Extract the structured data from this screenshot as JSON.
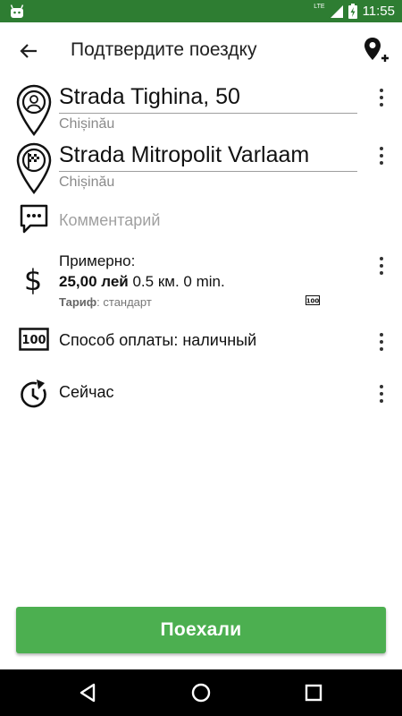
{
  "status_bar": {
    "network": "LTE",
    "time": "11:55"
  },
  "toolbar": {
    "title": "Подтвердите поездку"
  },
  "route": {
    "from": {
      "address": "Strada Tighina, 50",
      "city": "Chișinău"
    },
    "to": {
      "address": "Strada Mitropolit Varlaam",
      "city": "Chișinău"
    }
  },
  "comment": {
    "placeholder": "Комментарий"
  },
  "price": {
    "label": "Примерно:",
    "amount": "25,00 лей",
    "details": " 0.5 км. 0 min.",
    "tariff_label": "Тариф",
    "tariff_value": ": стандарт"
  },
  "payment": {
    "label": "Способ оплаты: наличный"
  },
  "time": {
    "label": "Сейчас"
  },
  "actions": {
    "go_label": "Поехали"
  },
  "colors": {
    "status_bar": "#2e7d32",
    "primary_button": "#4caf50"
  }
}
